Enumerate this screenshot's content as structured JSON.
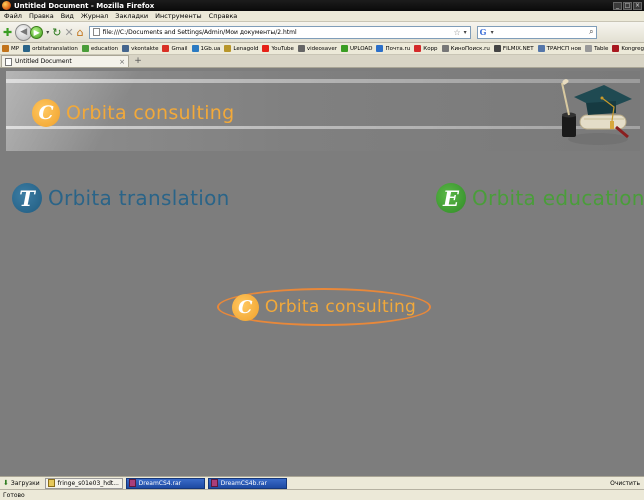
{
  "window": {
    "title": "Untitled Document - Mozilla Firefox"
  },
  "menu": [
    "Файл",
    "Правка",
    "Вид",
    "Журнал",
    "Закладки",
    "Инструменты",
    "Справка"
  ],
  "nav": {
    "url": "file:///C:/Documents and Settings/Admin/Мои документы/2.html"
  },
  "bookmarks": [
    {
      "label": "MP",
      "color": "#c2741b"
    },
    {
      "label": "orbitatranslation",
      "color": "#2a6488"
    },
    {
      "label": "education",
      "color": "#4a9d3a"
    },
    {
      "label": "vkontakte",
      "color": "#45668e"
    },
    {
      "label": "Gmail",
      "color": "#d93025"
    },
    {
      "label": "1Gb.ua",
      "color": "#2a7ac2"
    },
    {
      "label": "Lenagold",
      "color": "#b8962a"
    },
    {
      "label": "YouTube",
      "color": "#e62117"
    },
    {
      "label": "videosaver",
      "color": "#666666"
    },
    {
      "label": "UPLOAD",
      "color": "#3a9d23"
    },
    {
      "label": "Почта.ru",
      "color": "#2b6fc9"
    },
    {
      "label": "Корр",
      "color": "#d42a2a"
    },
    {
      "label": "КиноПоиск.ru",
      "color": "#777777"
    },
    {
      "label": "FILMIX.NET",
      "color": "#444444"
    },
    {
      "label": "ТРАНСП нов",
      "color": "#5577aa"
    },
    {
      "label": "Table",
      "color": "#999999"
    },
    {
      "label": "Kongregate",
      "color": "#a8181f"
    }
  ],
  "tabs": [
    {
      "label": "Untitled Document"
    }
  ],
  "content": {
    "banner_brand": {
      "letter": "C",
      "word": "Orbita consulting"
    },
    "translation": {
      "letter": "T",
      "word": "Orbita translation"
    },
    "education": {
      "letter": "E",
      "word": "Orbita education"
    },
    "consulting": {
      "letter": "C",
      "word": "Orbita consulting"
    }
  },
  "downloads": {
    "label": "Загрузки",
    "items": [
      {
        "name": "fringe_s01e03_hdt..."
      },
      {
        "name": "DreamCS4.rar"
      },
      {
        "name": "DreamCS4b.rar"
      }
    ],
    "clear_label": "Очистить"
  },
  "status": {
    "text": "Готово"
  },
  "colors": {
    "consulting_orange": "#f2a93a",
    "translation_blue": "#2a6488",
    "education_green": "#4a9d3a",
    "page_background": "#7d7d7d"
  }
}
